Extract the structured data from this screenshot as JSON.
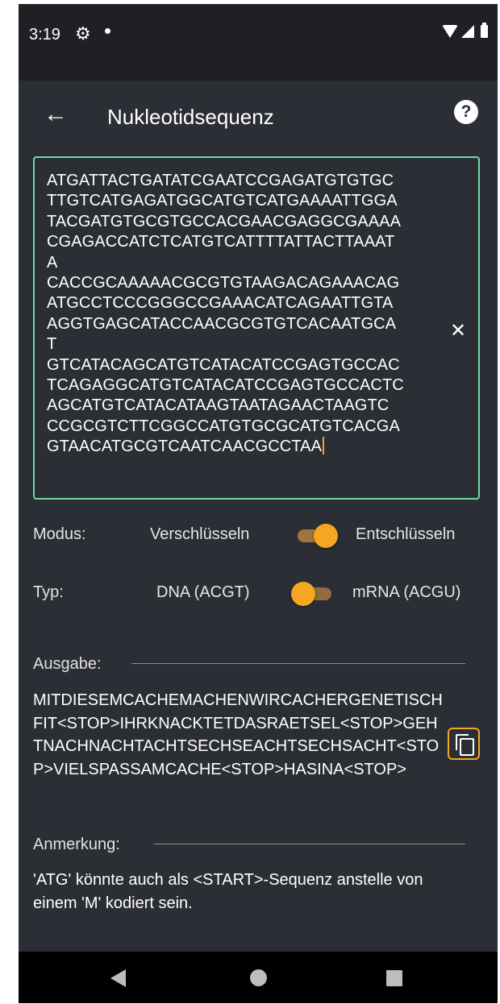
{
  "status_bar": {
    "time": "3:19"
  },
  "app_bar": {
    "title": "Nukleotidsequenz"
  },
  "input": {
    "sequence_lines": [
      "ATGATTACTGATATCGAATCCGAGATGTGTGC",
      "TTGTCATGAGATGGCATGTCATGAAAATTGGA",
      "TACGATGTGCGTGCCACGAACGAGGCGAAAA",
      "CGAGACCATCTCATGTCATTTTATTACTTAAAT",
      "A",
      "CACCGCAAAAACGCGTGTAAGACAGAAACAG",
      "ATGCCTCCCGGGCCGAAACATCAGAATTGTA",
      "AGGTGAGCATACCAACGCGTGTCACAATGCA",
      "T",
      "GTCATACAGCATGTCATACATCCGAGTGCCAC",
      "TCAGAGGCATGTCATACATCCGAGTGCCACTC",
      "AGCATGTCATACATAAGTAATAGAACTAAGTC",
      "CCGCGTCTTCGGCCATGTGCGCATGTCACGA",
      "GTAACATGCGTCAATCAACGCCTAA"
    ]
  },
  "mode": {
    "label": "Modus:",
    "option_left": "Verschlüsseln",
    "option_right": "Entschlüsseln",
    "selected": "Entschlüsseln"
  },
  "type": {
    "label": "Typ:",
    "option_left": "DNA (ACGT)",
    "option_right": "mRNA (ACGU)",
    "selected": "DNA (ACGT)"
  },
  "output": {
    "label": "Ausgabe:",
    "text": "MITDIESEMCACHEMACHENWIRCACHERGENETISCHFIT<STOP>IHRKNACKTETDASRAETSEL<STOP>GEHTNACHNACHTACHTSECHSEACHTSECHSACHT<STOP>VIELSPASSAMCACHE<STOP>HASINA<STOP>"
  },
  "note": {
    "label": "Anmerkung:",
    "text": "'ATG' könnte auch als <START>-Sequenz anstelle von einem 'M' kodiert sein."
  },
  "colors": {
    "accent": "#f5a623",
    "focus_border": "#6fdaa7",
    "background": "#2c2e35",
    "statusbar": "#1f2024"
  }
}
